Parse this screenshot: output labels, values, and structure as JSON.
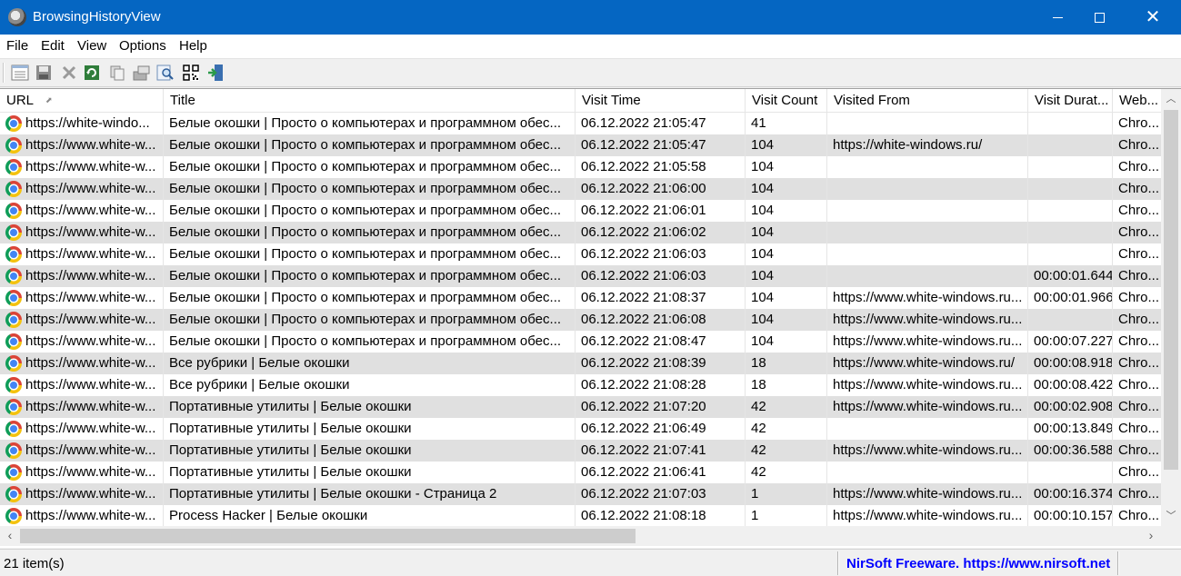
{
  "window": {
    "title": "BrowsingHistoryView",
    "app_icon": "browsinghistoryview-icon"
  },
  "menu": [
    "File",
    "Edit",
    "View",
    "Options",
    "Help"
  ],
  "toolbar": {
    "buttons": [
      {
        "name": "properties-icon"
      },
      {
        "name": "save-icon"
      },
      {
        "name": "delete-icon"
      },
      {
        "name": "refresh-icon"
      },
      {
        "name": "copy-icon"
      },
      {
        "name": "export-icon"
      },
      {
        "name": "find-icon"
      },
      {
        "name": "qr-code-icon"
      },
      {
        "name": "exit-icon"
      }
    ]
  },
  "columns": [
    "URL",
    "Title",
    "Visit Time",
    "Visit Count",
    "Visited From",
    "Visit Durat...",
    "Web..."
  ],
  "rows": [
    {
      "url": "https://white-windo...",
      "title": "Белые окошки | Просто о компьютерах и программном обес...",
      "time": "06.12.2022 21:05:47",
      "count": "41",
      "from": "",
      "dur": "",
      "web": "Chro..."
    },
    {
      "url": "https://www.white-w...",
      "title": "Белые окошки | Просто о компьютерах и программном обес...",
      "time": "06.12.2022 21:05:47",
      "count": "104",
      "from": "https://white-windows.ru/",
      "dur": "",
      "web": "Chro..."
    },
    {
      "url": "https://www.white-w...",
      "title": "Белые окошки | Просто о компьютерах и программном обес...",
      "time": "06.12.2022 21:05:58",
      "count": "104",
      "from": "",
      "dur": "",
      "web": "Chro..."
    },
    {
      "url": "https://www.white-w...",
      "title": "Белые окошки | Просто о компьютерах и программном обес...",
      "time": "06.12.2022 21:06:00",
      "count": "104",
      "from": "",
      "dur": "",
      "web": "Chro..."
    },
    {
      "url": "https://www.white-w...",
      "title": "Белые окошки | Просто о компьютерах и программном обес...",
      "time": "06.12.2022 21:06:01",
      "count": "104",
      "from": "",
      "dur": "",
      "web": "Chro..."
    },
    {
      "url": "https://www.white-w...",
      "title": "Белые окошки | Просто о компьютерах и программном обес...",
      "time": "06.12.2022 21:06:02",
      "count": "104",
      "from": "",
      "dur": "",
      "web": "Chro..."
    },
    {
      "url": "https://www.white-w...",
      "title": "Белые окошки | Просто о компьютерах и программном обес...",
      "time": "06.12.2022 21:06:03",
      "count": "104",
      "from": "",
      "dur": "",
      "web": "Chro..."
    },
    {
      "url": "https://www.white-w...",
      "title": "Белые окошки | Просто о компьютерах и программном обес...",
      "time": "06.12.2022 21:06:03",
      "count": "104",
      "from": "",
      "dur": "00:00:01.644",
      "web": "Chro..."
    },
    {
      "url": "https://www.white-w...",
      "title": "Белые окошки | Просто о компьютерах и программном обес...",
      "time": "06.12.2022 21:08:37",
      "count": "104",
      "from": "https://www.white-windows.ru...",
      "dur": "00:00:01.966",
      "web": "Chro..."
    },
    {
      "url": "https://www.white-w...",
      "title": "Белые окошки | Просто о компьютерах и программном обес...",
      "time": "06.12.2022 21:06:08",
      "count": "104",
      "from": "https://www.white-windows.ru...",
      "dur": "",
      "web": "Chro..."
    },
    {
      "url": "https://www.white-w...",
      "title": "Белые окошки | Просто о компьютерах и программном обес...",
      "time": "06.12.2022 21:08:47",
      "count": "104",
      "from": "https://www.white-windows.ru...",
      "dur": "00:00:07.227",
      "web": "Chro..."
    },
    {
      "url": "https://www.white-w...",
      "title": "Все рубрики | Белые окошки",
      "time": "06.12.2022 21:08:39",
      "count": "18",
      "from": "https://www.white-windows.ru/",
      "dur": "00:00:08.918",
      "web": "Chro..."
    },
    {
      "url": "https://www.white-w...",
      "title": "Все рубрики | Белые окошки",
      "time": "06.12.2022 21:08:28",
      "count": "18",
      "from": "https://www.white-windows.ru...",
      "dur": "00:00:08.422",
      "web": "Chro..."
    },
    {
      "url": "https://www.white-w...",
      "title": "Портативные утилиты | Белые окошки",
      "time": "06.12.2022 21:07:20",
      "count": "42",
      "from": "https://www.white-windows.ru...",
      "dur": "00:00:02.908",
      "web": "Chro..."
    },
    {
      "url": "https://www.white-w...",
      "title": "Портативные утилиты | Белые окошки",
      "time": "06.12.2022 21:06:49",
      "count": "42",
      "from": "",
      "dur": "00:00:13.849",
      "web": "Chro..."
    },
    {
      "url": "https://www.white-w...",
      "title": "Портативные утилиты | Белые окошки",
      "time": "06.12.2022 21:07:41",
      "count": "42",
      "from": "https://www.white-windows.ru...",
      "dur": "00:00:36.588",
      "web": "Chro..."
    },
    {
      "url": "https://www.white-w...",
      "title": "Портативные утилиты | Белые окошки",
      "time": "06.12.2022 21:06:41",
      "count": "42",
      "from": "",
      "dur": "",
      "web": "Chro..."
    },
    {
      "url": "https://www.white-w...",
      "title": "Портативные утилиты | Белые окошки - Страница 2",
      "time": "06.12.2022 21:07:03",
      "count": "1",
      "from": "https://www.white-windows.ru...",
      "dur": "00:00:16.374",
      "web": "Chro..."
    },
    {
      "url": "https://www.white-w...",
      "title": "Process Hacker | Белые окошки",
      "time": "06.12.2022 21:08:18",
      "count": "1",
      "from": "https://www.white-windows.ru...",
      "dur": "00:00:10.157",
      "web": "Chro..."
    }
  ],
  "status": {
    "count": "21 item(s)",
    "link": "NirSoft Freeware. https://www.nirsoft.net"
  },
  "colors": {
    "titlebar": "#0566c2",
    "alt_row": "#e0e0e0",
    "status_link": "#0000ff"
  }
}
